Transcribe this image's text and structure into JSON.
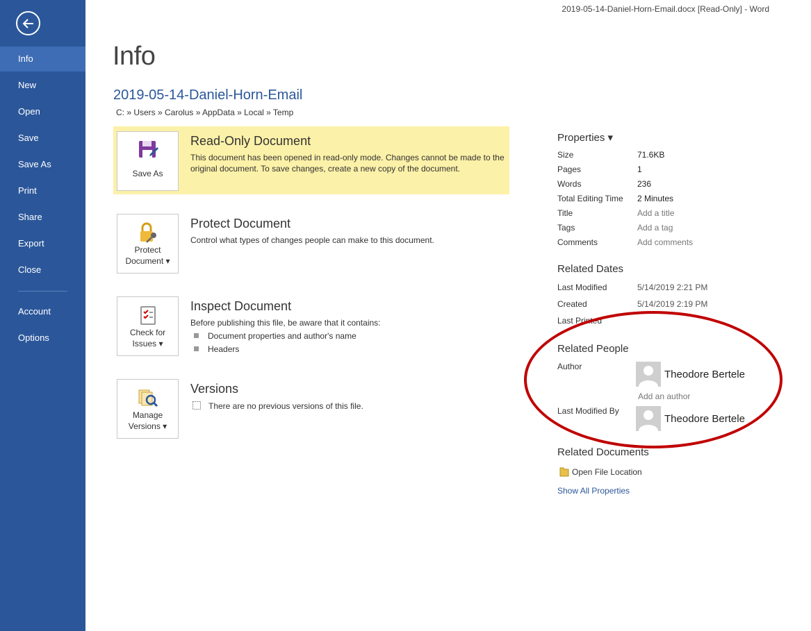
{
  "window": {
    "title": "2019-05-14-Daniel-Horn-Email.docx [Read-Only] - Word"
  },
  "sidebar": {
    "back_icon": "back-arrow-icon",
    "items": [
      {
        "label": "Info",
        "active": true
      },
      {
        "label": "New"
      },
      {
        "label": "Open"
      },
      {
        "label": "Save"
      },
      {
        "label": "Save As"
      },
      {
        "label": "Print"
      },
      {
        "label": "Share"
      },
      {
        "label": "Export"
      },
      {
        "label": "Close"
      },
      {
        "label": "Account"
      },
      {
        "label": "Options"
      }
    ]
  },
  "main": {
    "page_title": "Info",
    "doc_name": "2019-05-14-Daniel-Horn-Email",
    "breadcrumb": "C: » Users » Carolus » AppData » Local » Temp",
    "sections": {
      "readonly": {
        "button_label": "Save As",
        "button_icon": "save-as-icon",
        "heading": "Read-Only Document",
        "description": "This document has been opened in read-only mode. Changes cannot be made to the original document. To save changes, create a new copy of the document."
      },
      "protect": {
        "button_line1": "Protect",
        "button_line2": "Document ▾",
        "button_icon": "lock-key-icon",
        "heading": "Protect Document",
        "description": "Control what types of changes people can make to this document."
      },
      "inspect": {
        "button_line1": "Check for",
        "button_line2": "Issues ▾",
        "button_icon": "checklist-icon",
        "heading": "Inspect Document",
        "description": "Before publishing this file, be aware that it contains:",
        "bullets": [
          "Document properties and author's name",
          "Headers"
        ]
      },
      "versions": {
        "button_line1": "Manage",
        "button_line2": "Versions ▾",
        "button_icon": "manage-versions-icon",
        "heading": "Versions",
        "description": "There are no previous versions of this file."
      }
    }
  },
  "properties": {
    "heading": "Properties ▾",
    "rows": [
      {
        "label": "Size",
        "value": "71.6KB"
      },
      {
        "label": "Pages",
        "value": "1"
      },
      {
        "label": "Words",
        "value": "236"
      },
      {
        "label": "Total Editing Time",
        "value": "2 Minutes"
      },
      {
        "label": "Title",
        "value": "Add a title"
      },
      {
        "label": "Tags",
        "value": "Add a tag"
      },
      {
        "label": "Comments",
        "value": "Add comments"
      }
    ]
  },
  "related_dates": {
    "heading": "Related Dates",
    "rows": [
      {
        "label": "Last Modified",
        "value": "5/14/2019 2:21 PM"
      },
      {
        "label": "Created",
        "value": "5/14/2019 2:19 PM"
      },
      {
        "label": "Last Printed",
        "value": ""
      }
    ]
  },
  "related_people": {
    "heading": "Related People",
    "author_label": "Author",
    "author_name": "Theodore Bertele",
    "add_author": "Add an author",
    "last_modified_label": "Last Modified By",
    "last_modified_name": "Theodore Bertele"
  },
  "related_documents": {
    "heading": "Related Documents",
    "open_location": "Open File Location",
    "show_all": "Show All Properties"
  },
  "colors": {
    "sidebar": "#2b579a",
    "accent": "#2b579a",
    "highlight": "#fcf1a8",
    "annotation": "#c00000"
  }
}
